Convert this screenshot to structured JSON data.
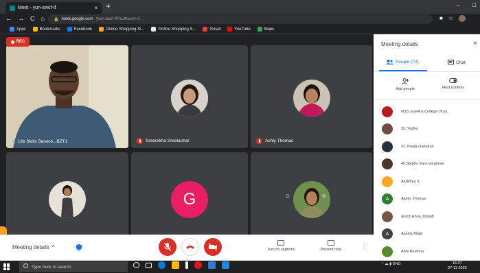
{
  "browser": {
    "tab_title": "Meet - yun-swcf-tf",
    "tab_close": "×",
    "new_tab": "+",
    "window_controls": [
      "–",
      "□"
    ],
    "nav": [
      "←",
      "→",
      "C",
      "⌂"
    ],
    "url_host": "meet.google.com",
    "url_path": "/yun-swcf-tf?authuser=1",
    "bookmarks": [
      {
        "label": "Apps",
        "color": "#4285f4"
      },
      {
        "label": "Bookmarks",
        "color": "#fbbc04"
      },
      {
        "label": "Facebook",
        "color": "#1877f2"
      },
      {
        "label": "Online Shopping Si...",
        "color": "#f9a825"
      },
      {
        "label": "Online Shopping S...",
        "color": "#e8eaed"
      },
      {
        "label": "Gmail",
        "color": "#ea4335"
      },
      {
        "label": "YouTube",
        "color": "#ff0000"
      },
      {
        "label": "Maps",
        "color": "#34a853"
      }
    ]
  },
  "meeting": {
    "rec_label": "REC",
    "tiles": [
      {
        "name": "Life Skills Service...BZT1"
      },
      {
        "name": "Sreerekha Sreekumar"
      },
      {
        "name": "Ashly Thomas"
      },
      {
        "name": ""
      },
      {
        "name": "",
        "letter": "G"
      },
      {
        "name": ""
      }
    ]
  },
  "controls": {
    "meeting_details": "Meeting details",
    "chevron": "^",
    "captions": "Turn on captions",
    "present": "Present now",
    "more": "⋮"
  },
  "panel": {
    "title": "Meeting details",
    "close": "×",
    "people_tab": "People (72)",
    "chat_tab": "Chat",
    "add_people": "Add people",
    "host_controls": "Host controls",
    "people": [
      {
        "name": "NSS Josellus College (You)",
        "avatar": "",
        "color": "#b71c1c"
      },
      {
        "name": "33. Yadhu",
        "avatar": "",
        "color": "#6d4c41"
      },
      {
        "name": "37. Pooja chandran",
        "avatar": "",
        "color": "#263238"
      },
      {
        "name": "45.Stephy Sara Varghese",
        "avatar": "",
        "color": "#4e342e"
      },
      {
        "name": "Aadithya S",
        "avatar": "",
        "color": "#f9a825"
      },
      {
        "name": "Aamic Thomas",
        "avatar": "A",
        "color": "#2e7d32"
      },
      {
        "name": "Aaron Anna Joseph",
        "avatar": "",
        "color": "#795548"
      },
      {
        "name": "Aasiba Majid",
        "avatar": "A",
        "color": "#424242"
      },
      {
        "name": "Abhi Reshma",
        "avatar": "",
        "color": "#558b2f"
      }
    ]
  },
  "taskbar": {
    "search_placeholder": "Type here to search",
    "tray": "^ ☁ ▮ ENG",
    "time": "15:27",
    "date": "07-11-2020",
    "apps": [
      "#ffffff",
      "#0078d4",
      "#0063b1",
      "#ffb900",
      "#ffffff",
      "#e81123",
      "#2b7cd3",
      "#1e88e5"
    ]
  },
  "colors": {
    "mute_red": "#d93025",
    "accent_blue": "#1a73e8",
    "g_avatar": "#e91e63"
  }
}
